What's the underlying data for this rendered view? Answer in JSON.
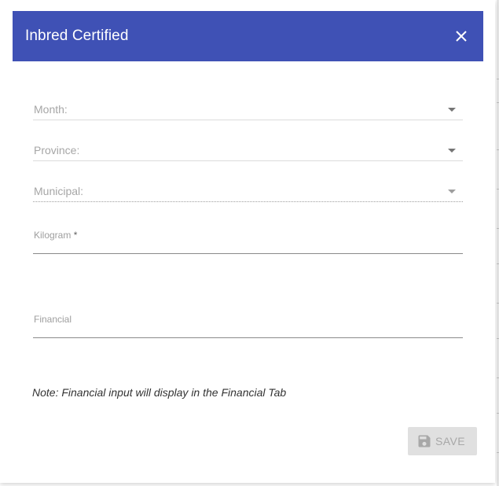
{
  "dialog": {
    "title": "Inbred Certified",
    "close_icon": "close-icon",
    "title_bar_color": "#3f51b5"
  },
  "form": {
    "month": {
      "label": "Month:"
    },
    "province": {
      "label": "Province:"
    },
    "municipal": {
      "label": "Municipal:"
    },
    "kilogram": {
      "label": "Kilogram",
      "required_marker": "*",
      "value": ""
    },
    "financial": {
      "label": "Financial",
      "value": ""
    }
  },
  "note": "Note: Financial input will display in the Financial Tab",
  "actions": {
    "save_label": "SAVE",
    "save_icon": "floppy-disk-icon",
    "save_disabled": true
  }
}
